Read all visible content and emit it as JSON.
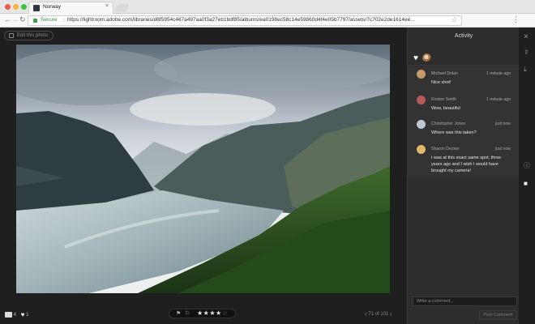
{
  "browser": {
    "tab_title": "Norway",
    "tab_close": "×",
    "secure_label": "Secure",
    "url_separator": "|",
    "url": "https://lightroom.adobe.com/libraries/d6f5954c467a497aa0f3a27eb1bdf85/albums/ea0198ec58c14e59860d4f4e05b7797/assets/7c702e2de1614ee...",
    "back_icon": "←",
    "forward_icon": "→",
    "reload_icon": "↻",
    "star_icon": "☆",
    "menu_icon": "⋮",
    "traffic_lights": [
      "#f2564f",
      "#f7b53a",
      "#38c643"
    ]
  },
  "app": {
    "edit_button": "Edit this photo",
    "comment_count": "4",
    "like_count": "1",
    "flag_pick": "⚑",
    "flag_reject": "⚐",
    "rating": 4,
    "rating_max": 5,
    "pager_text": "71 of 101",
    "pager_prev": "‹",
    "pager_next": "›"
  },
  "panel": {
    "title": "Activity",
    "comment_placeholder": "Write a comment...",
    "post_button": "Post Comment",
    "comments": [
      {
        "name": "Michael Dolan",
        "time": "1 minute ago",
        "text": "Nice shot!",
        "avatar_color": "#c89a6a"
      },
      {
        "name": "Kirsten Smith",
        "time": "1 minute ago",
        "text": "Wow, beautiful",
        "avatar_color": "#b85b5b"
      },
      {
        "name": "Christopher Jones",
        "time": "just now",
        "text": "Where was this taken?",
        "avatar_color": "#bfc6d1"
      },
      {
        "name": "Sharon Decker",
        "time": "just now",
        "text": "I was at this exact same spot, three years ago and I wish I would have brought my camera!",
        "avatar_color": "#e5b76a"
      }
    ]
  },
  "rail_icons": [
    "close-icon",
    "share-icon",
    "download-icon",
    "info-icon",
    "comment-icon"
  ]
}
